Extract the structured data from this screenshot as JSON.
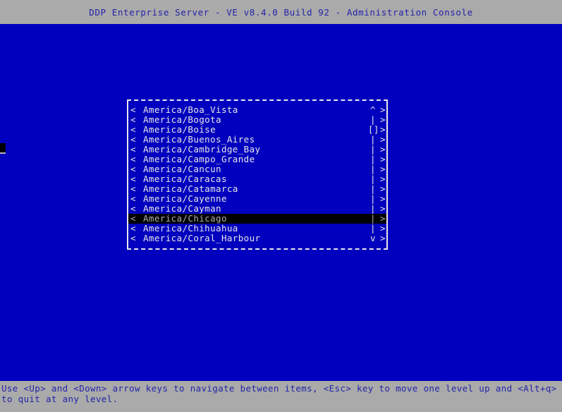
{
  "titlebar": {
    "title": "DDP Enterprise Server - VE v8.4.0 Build 92 - Administration Console"
  },
  "colors": {
    "screen_background": "#0000be",
    "bar_background": "#aaaaaa",
    "bar_text": "#2323a8",
    "list_text": "#e8e8e8",
    "selection_background": "#000000",
    "selection_text": "#b0b0b0",
    "border": "#e8e8e8"
  },
  "dialog": {
    "left_caret": "<",
    "right_caret": ">",
    "scrollbar": {
      "up_arrow": "^",
      "track": "|",
      "thumb": "[]",
      "down_arrow": "v"
    },
    "items": [
      {
        "label": "America/Boa_Vista",
        "scroll": "^",
        "selected": false
      },
      {
        "label": "America/Bogota",
        "scroll": "|",
        "selected": false
      },
      {
        "label": "America/Boise",
        "scroll": "[]",
        "selected": false
      },
      {
        "label": "America/Buenos_Aires",
        "scroll": "|",
        "selected": false
      },
      {
        "label": "America/Cambridge_Bay",
        "scroll": "|",
        "selected": false
      },
      {
        "label": "America/Campo_Grande",
        "scroll": "|",
        "selected": false
      },
      {
        "label": "America/Cancun",
        "scroll": "|",
        "selected": false
      },
      {
        "label": "America/Caracas",
        "scroll": "|",
        "selected": false
      },
      {
        "label": "America/Catamarca",
        "scroll": "|",
        "selected": false
      },
      {
        "label": "America/Cayenne",
        "scroll": "|",
        "selected": false
      },
      {
        "label": "America/Cayman",
        "scroll": "|",
        "selected": false
      },
      {
        "label": "America/Chicago",
        "scroll": "|",
        "selected": true
      },
      {
        "label": "America/Chihuahua",
        "scroll": "|",
        "selected": false
      },
      {
        "label": "America/Coral_Harbour",
        "scroll": "v",
        "selected": false
      }
    ]
  },
  "statusbar": {
    "hint": "Use <Up> and <Down> arrow keys to navigate between items, <Esc> key to move one level up and <Alt+q> to quit at any level."
  }
}
